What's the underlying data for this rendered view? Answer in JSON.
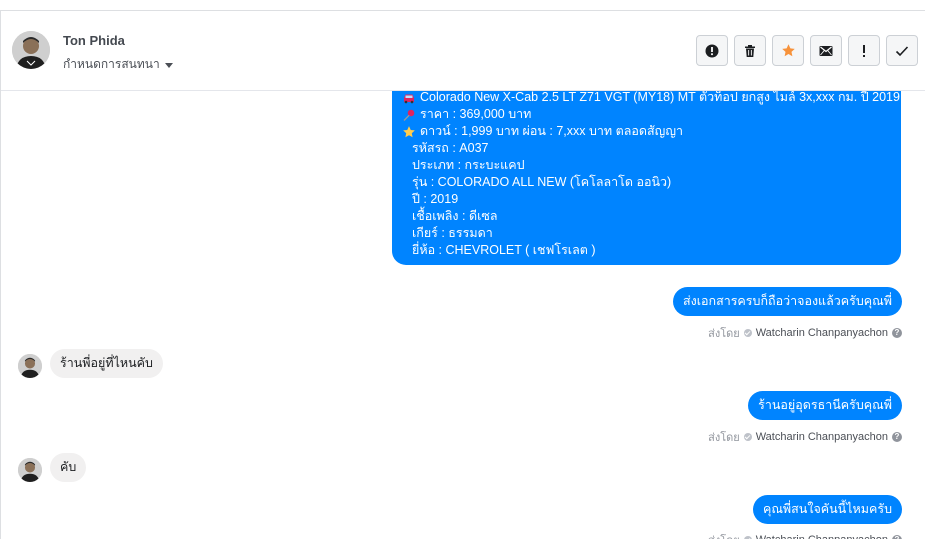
{
  "header": {
    "name": "Ton Phida",
    "subtitle": "กำหนดการสนทนา"
  },
  "toolbar": {
    "buttons": [
      {
        "icon": "alert-circle-icon",
        "label": ""
      },
      {
        "icon": "trash-icon",
        "label": ""
      },
      {
        "icon": "star-icon",
        "color": "#f7923b",
        "label": ""
      },
      {
        "icon": "envelope-icon",
        "label": ""
      },
      {
        "icon": "exclamation-icon",
        "label": ""
      },
      {
        "icon": "check-icon",
        "label": ""
      }
    ]
  },
  "colors": {
    "outgoing_bubble": "#0084ff",
    "incoming_bubble": "#f1f0f0",
    "star": "#f7923b"
  },
  "messages": {
    "card": {
      "title": "Colorado New X-Cab 2.5 LT Z71 VGT (MY18) MT ตัวท็อป ยกสูง ไมล์ 3x,xxx กม. ปี 2019",
      "price": "ราคา : 369,000 บาท",
      "down": "ดาวน์ : 1,999 บาท ผ่อน : 7,xxx  บาท ตลอดสัญญา",
      "code": "รหัสรถ : A037",
      "type": "ประเภท : กระบะแคป",
      "model": "รุ่น : COLORADO ALL NEW (โคโลลาโด ออนิว)",
      "year": "ปี : 2019",
      "fuel": "เชื้อเพลิง : ดีเซล",
      "gear": "เกียร์ : ธรรมดา",
      "brand": "ยี่ห้อ : CHEVROLET ( เชฟโรเลต )"
    },
    "out1": "ส่งเอกสารครบก็ถือว่าจองแล้วครับคุณพี่",
    "in1": "ร้านพี่อยู่ที่ไหนคับ",
    "out2": "ร้านอยู่อุดรธานีครับคุณพี่",
    "in2": "คับ",
    "out3": "คุณพี่สนใจคันนี้ไหมครับ",
    "sent_by_prefix": "ส่งโดย",
    "sent_by_agent": "Watcharin Chanpanyachon"
  }
}
